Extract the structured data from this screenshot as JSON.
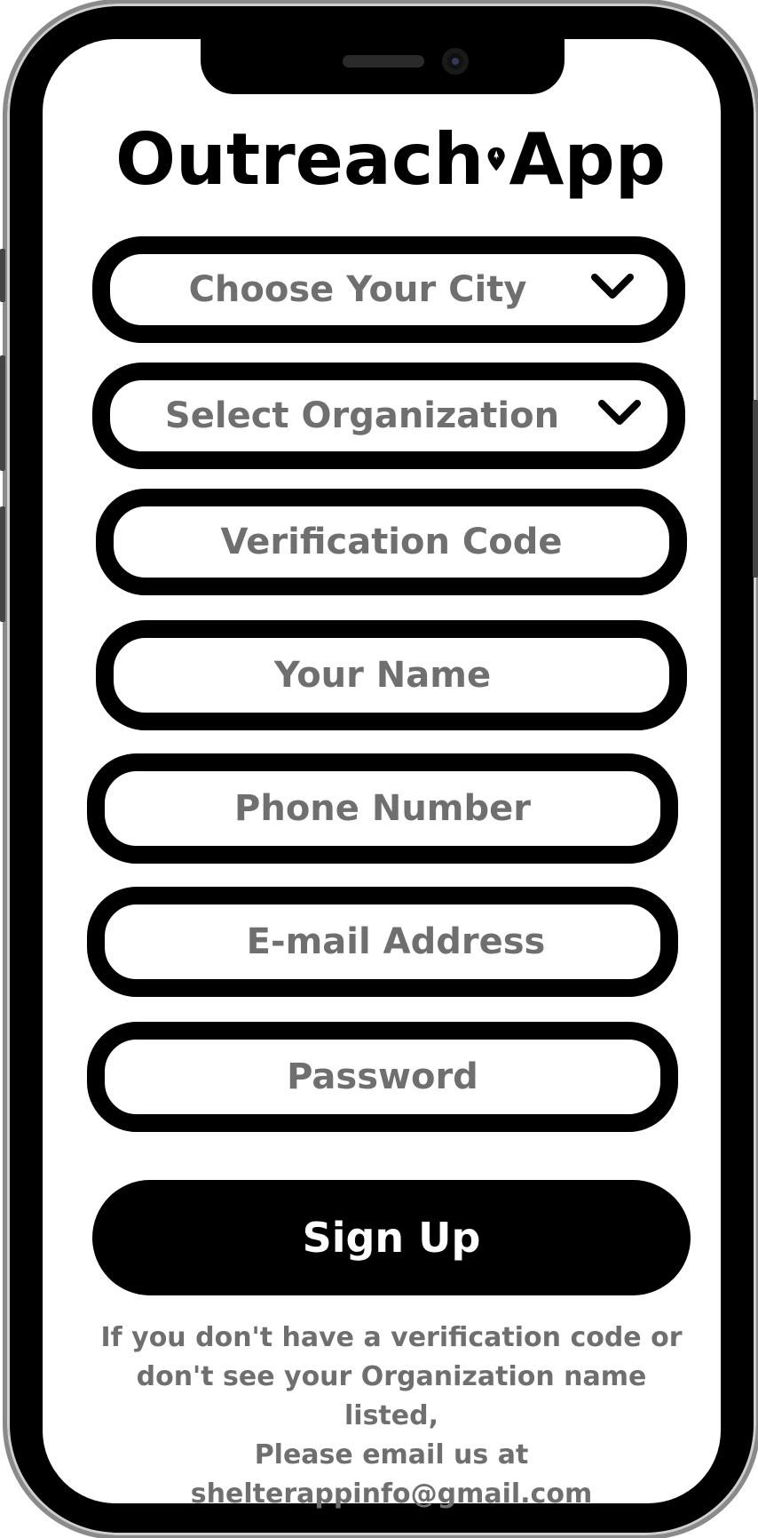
{
  "brand": {
    "name_left": "Outreach",
    "name_right": "App",
    "logo_icon": "map-pin-icon"
  },
  "form": {
    "city_placeholder": "Choose Your City",
    "organization_placeholder": "Select Organization",
    "verification_placeholder": "Verification Code",
    "name_placeholder": "Your Name",
    "phone_placeholder": "Phone Number",
    "email_placeholder": "E-mail Address",
    "password_placeholder": "Password",
    "dropdown_icon": "chevron-down-icon",
    "signup_label": "Sign Up"
  },
  "help": {
    "line1": "If you don't have a verification code or",
    "line2": "don't see your Organization name listed,",
    "line3": "Please email us at",
    "line4": "shelterappinfo@gmail.com"
  },
  "colors": {
    "frame": "#000000",
    "placeholder_text": "#6f6f6f",
    "button_bg": "#000000",
    "button_text": "#ffffff"
  }
}
